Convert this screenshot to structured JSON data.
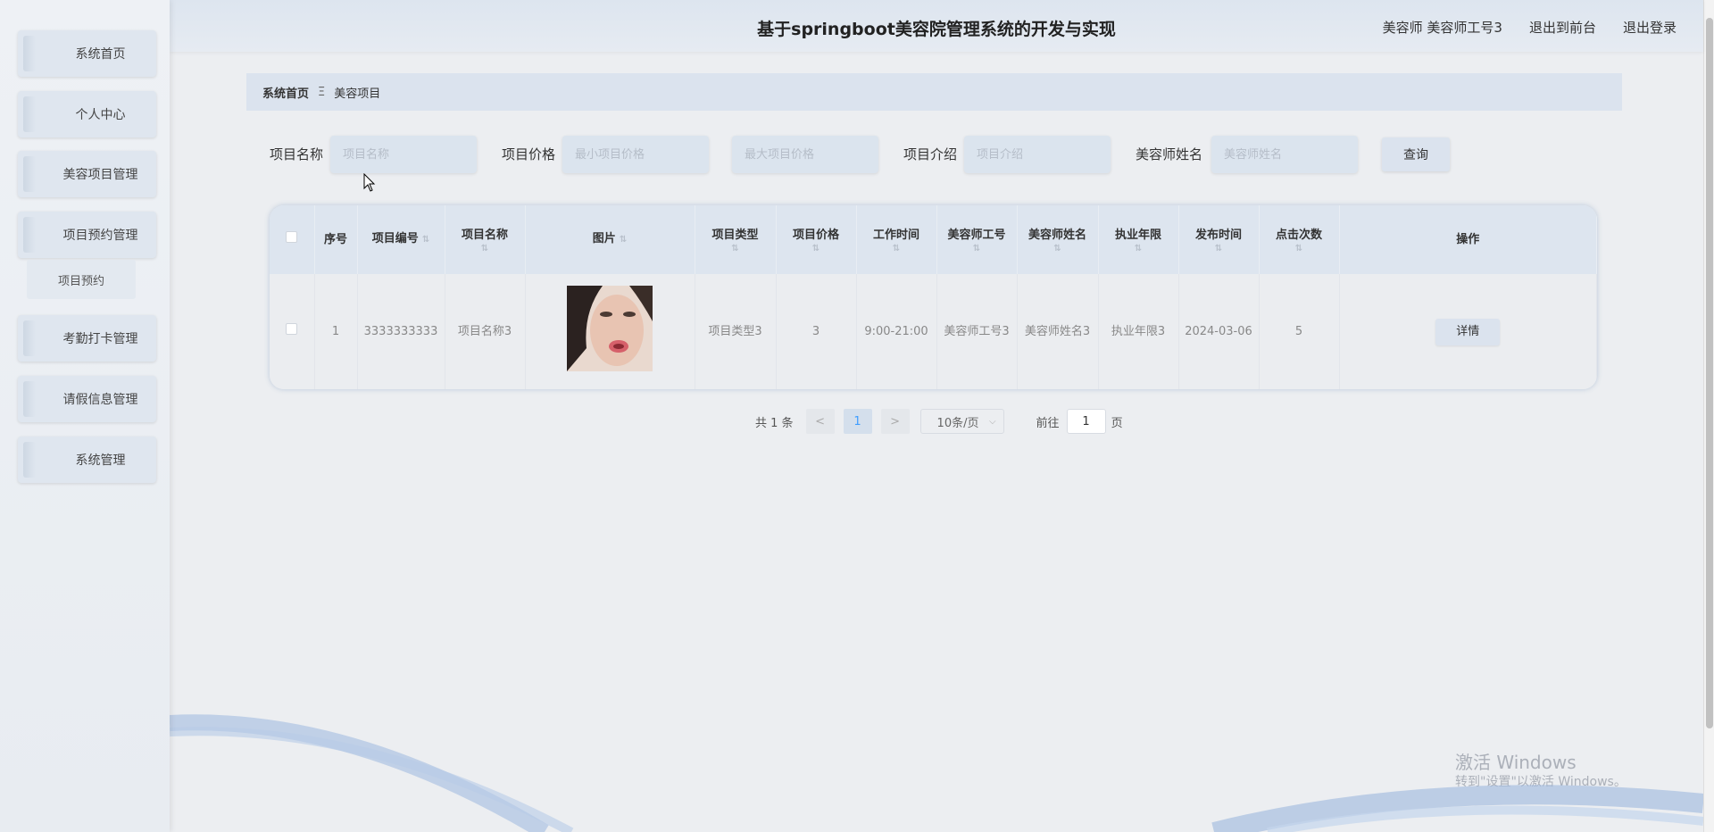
{
  "header": {
    "title": "基于springboot美容院管理系统的开发与实现",
    "user": "美容师 美容师工号3",
    "to_front": "退出到前台",
    "logout": "退出登录"
  },
  "sidebar": {
    "items": [
      {
        "label": "系统首页"
      },
      {
        "label": "个人中心"
      },
      {
        "label": "美容项目管理"
      },
      {
        "label": "项目预约管理"
      },
      {
        "label": "考勤打卡管理"
      },
      {
        "label": "请假信息管理"
      },
      {
        "label": "系统管理"
      }
    ],
    "subitem": "项目预约"
  },
  "breadcrumb": {
    "home": "系统首页",
    "separator": "Ξ",
    "current": "美容项目"
  },
  "search": {
    "name_label": "项目名称",
    "name_placeholder": "项目名称",
    "price_label": "项目价格",
    "min_price_placeholder": "最小项目价格",
    "max_price_placeholder": "最大项目价格",
    "intro_label": "项目介绍",
    "intro_placeholder": "项目介绍",
    "staff_label": "美容师姓名",
    "staff_placeholder": "美容师姓名",
    "query_button": "查询"
  },
  "table": {
    "headers": {
      "index": "序号",
      "code": "项目编号",
      "name": "项目名称",
      "image": "图片",
      "type": "项目类型",
      "price": "项目价格",
      "work_time": "工作时间",
      "staff_no": "美容师工号",
      "staff_name": "美容师姓名",
      "years": "执业年限",
      "publish_time": "发布时间",
      "clicks": "点击次数",
      "action": "操作"
    },
    "rows": [
      {
        "index": "1",
        "code": "3333333333",
        "name": "项目名称3",
        "type": "项目类型3",
        "price": "3",
        "work_time": "9:00-21:00",
        "staff_no": "美容师工号3",
        "staff_name": "美容师姓名3",
        "years": "执业年限3",
        "publish_time": "2024-03-06",
        "clicks": "5",
        "detail": "详情"
      }
    ]
  },
  "pagination": {
    "total": "共 1 条",
    "prev": "<",
    "current": "1",
    "next": ">",
    "page_size": "10条/页",
    "goto_prefix": "前往",
    "goto_value": "1",
    "goto_suffix": "页"
  },
  "watermark": {
    "line1": "激活 Windows",
    "line2": "转到\"设置\"以激活 Windows。"
  }
}
